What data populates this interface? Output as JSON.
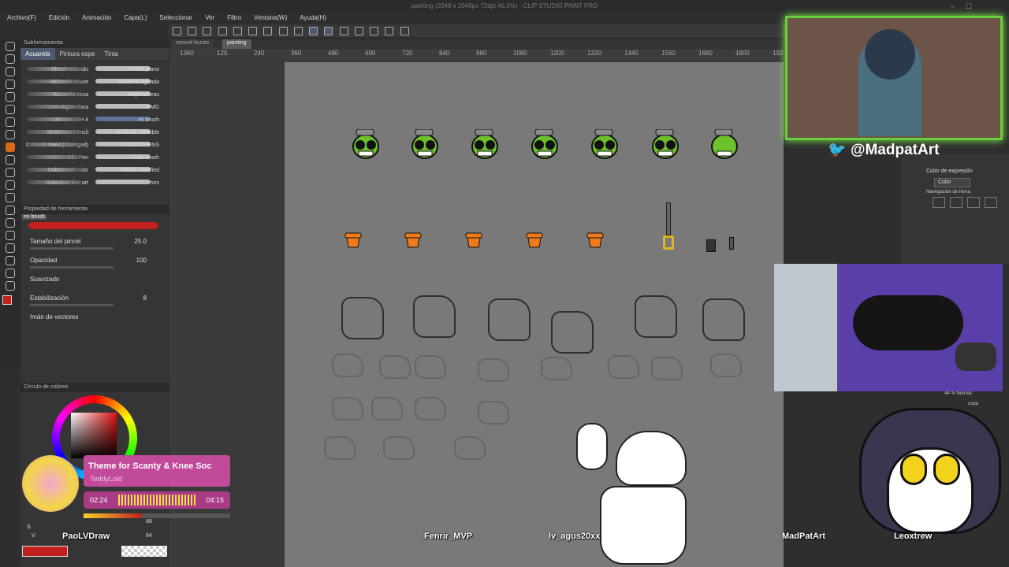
{
  "app": {
    "title": "painting (2048 x 2048px 72dpi 46.3%) - CLIP STUDIO PAINT PRO"
  },
  "menu": [
    "Archivo(F)",
    "Edición",
    "Animación",
    "Capa(L)",
    "Seleccionar",
    "Ver",
    "Filtro",
    "Ventana(W)",
    "Ayuda(H)"
  ],
  "canvas_tabs": [
    "romnel kunito",
    "painting"
  ],
  "ruler_ticks": [
    "1360",
    "120",
    "240",
    "360",
    "480",
    "600",
    "720",
    "840",
    "960",
    "1080",
    "1200",
    "1320",
    "1440",
    "1560",
    "1680",
    "1800",
    "1920"
  ],
  "subtool": {
    "header": "Subherramienta",
    "tabs": [
      "Acuarela",
      "Pintura espe",
      "Tinta"
    ],
    "brushes_left": [
      "Pincel redondo",
      "Húmedo suave",
      "Acuarela seca",
      "Agua clara",
      "JEKBRUSH 4",
      "Str Dream Pencil",
      "Colored Trees (Changed)",
      "Bibi Pen",
      "Colorbrush color",
      "Succubus line art"
    ],
    "brushes_right": [
      "Pincel plano",
      "Acuarela aguada",
      "Salpicaduras",
      "HMG",
      "mi brush",
      "mi brush sensible",
      "mi brush SENS",
      "Colo brush",
      "HMGG modified",
      "sex"
    ]
  },
  "tool_property": {
    "header": "Propiedad de herramienta",
    "brush_name": "mi brush",
    "size_label": "Tamaño del pincel",
    "size_value": "25.0",
    "opacity_label": "Opacidad",
    "opacity_value": "100",
    "smooth_label": "Suavizado",
    "stab_label": "Estabilización",
    "stab_value": "8",
    "vector_label": "Imán de vectores"
  },
  "color_circle": {
    "header": "Círculo de colores",
    "h_label": "S",
    "h_value": "88",
    "v_label": "V",
    "v_value": "64"
  },
  "music": {
    "title": "Theme for Scanty & Knee Soc",
    "artist": "TeddyLoid",
    "elapsed": "02:24",
    "total": "04:15"
  },
  "right_panel": {
    "color_label": "Color de expresión",
    "color_value": "Color",
    "nav_label": "Navegación de herra"
  },
  "layer_panel": {
    "opacity": "44 % Normal",
    "item2": "copa"
  },
  "twitter": "@MadpatArt",
  "viewers": [
    "PaoLVDraw",
    "Fenrir_MVP",
    "lv_agus20xx",
    "MadPatArt",
    "Leoxtrew"
  ],
  "colors": {
    "accent": "#67d03a",
    "brush_red": "#c32020",
    "head_green": "#6cc22a",
    "cup_orange": "#f07a1a",
    "purple_bed": "#6a45c0"
  }
}
